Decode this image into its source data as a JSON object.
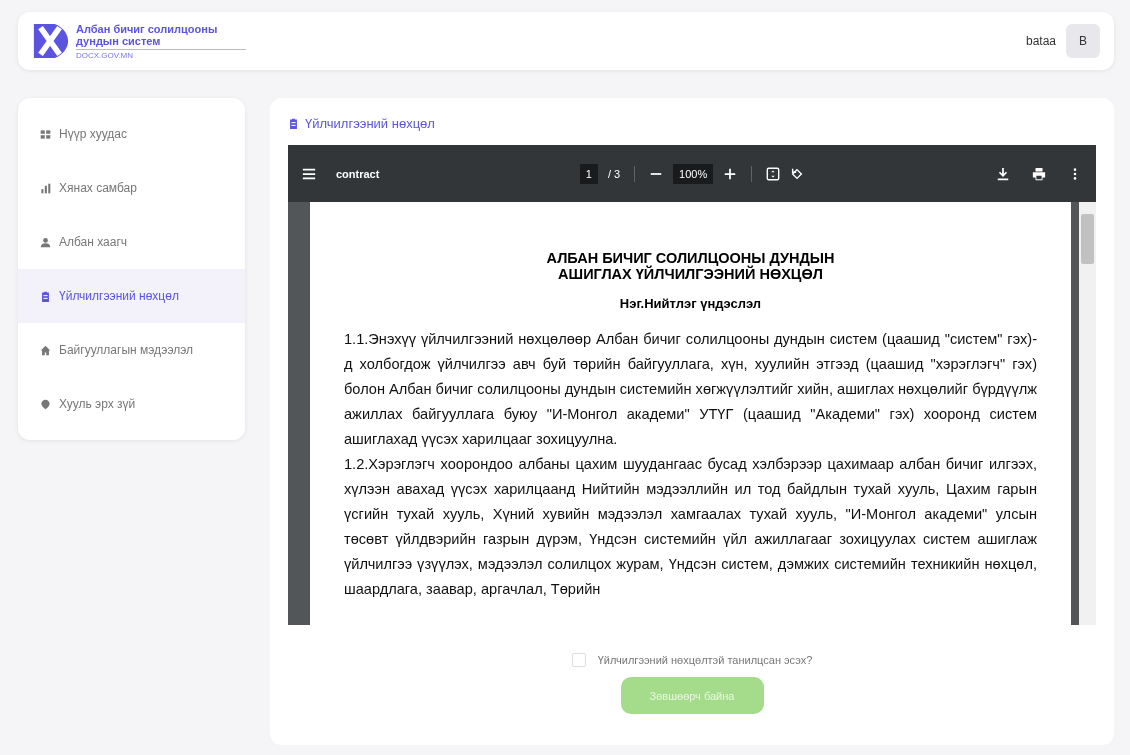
{
  "header": {
    "logo_title": "Албан бичиг солилцооны дундын систем",
    "logo_subtitle": "DOCX.GOV.MN",
    "user_name": "bataa",
    "avatar_letter": "B"
  },
  "sidebar": {
    "items": [
      {
        "label": "Нүүр хуудас",
        "selected": false
      },
      {
        "label": "Хянах самбар",
        "selected": false
      },
      {
        "label": "Албан хаагч",
        "selected": false
      },
      {
        "label": "Үйлчилгээний нөхцөл",
        "selected": true
      },
      {
        "label": "Байгууллагын мэдээлэл",
        "selected": false
      },
      {
        "label": "Хууль эрх зүй",
        "selected": false
      }
    ]
  },
  "content": {
    "title": "Үйлчилгээний нөхцөл",
    "pdf_viewer": {
      "file_name": "contract",
      "page": "1",
      "page_total": "/ 3",
      "zoom": "100%",
      "document": {
        "title_lines": [
          "АЛБАН БИЧИГ СОЛИЛЦООНЫ ДУНДЫН",
          "АШИГЛАХ ҮЙЛЧИЛГЭЭНИЙ НӨХЦӨЛ"
        ],
        "section": "Нэг.Нийтлэг үндэслэл",
        "paragraphs": [
          "1.1.Энэхүү үйлчилгээний нөхцөлөөр Албан бичиг солилцооны дундын систем (цаашид \"систем\" гэх)- д холбогдож үйлчилгээ авч буй төрийн байгууллага, хүн, хуулийн этгээд (цаашид \"хэрэглэгч\" гэх) болон Албан бичиг солилцооны дундын системийн хөгжүүлэлтийг хийн, ашиглах нөхцөлийг бүрдүүлж ажиллах байгууллага буюу \"И-Монгол академи\" УТҮГ (цаашид \"Академи\" гэх)  хооронд систем ашиглахад үүсэх харилцааг зохицуулна.",
          "1.2.Хэрэглэгч хоорондоо албаны цахим шуудангаас бусад хэлбэрээр цахимаар албан бичиг илгээх, хүлээн авахад үүсэх харилцаанд Нийтийн мэдээллийн ил тод байдлын тухай хууль, Цахим гарын үсгийн тухай хууль, Хүний хувийн мэдээлэл хамгаалах тухай хууль, \"И-Монгол академи\" улсын төсөвт үйлдвэрийн газрын дүрэм, Үндсэн системийн үйл ажиллагааг зохицуулах систем ашиглаж үйлчилгээ үзүүлэх, мэдээлэл солилцох журам, Үндсэн систем, дэмжих системийн техникийн нөхцөл, шаардлага, заавар, аргачлал, Төрийн"
        ]
      }
    },
    "agreement": {
      "label": "Үйлчилгээний нөхцөлтэй танилцсан эсэх?",
      "checked": false
    },
    "submit": {
      "label": "Зөвшөөрч байна",
      "disabled": true
    }
  }
}
